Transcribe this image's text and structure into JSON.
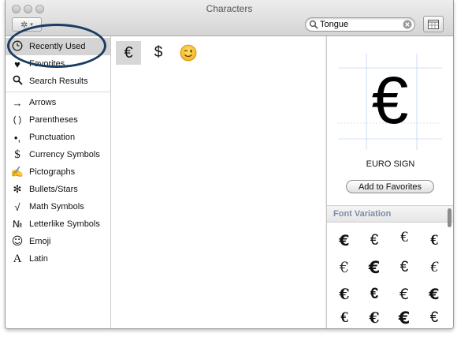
{
  "window": {
    "title": "Characters"
  },
  "toolbar": {
    "gear_icon": "gear-icon",
    "search_value": "Tongue",
    "search_icon": "magnifier-icon",
    "clear_icon": "clear-icon",
    "grid_icon": "character-grid-icon"
  },
  "sidebar": {
    "items": [
      {
        "label": "Recently Used",
        "icon": "🕒",
        "selected": true
      },
      {
        "label": "Favorites",
        "icon": "♥"
      },
      {
        "label": "Search Results",
        "icon": "🔍"
      },
      {
        "label": "Arrows",
        "icon": "→"
      },
      {
        "label": "Parentheses",
        "icon": "( )"
      },
      {
        "label": "Punctuation",
        "icon": "•,"
      },
      {
        "label": "Currency Symbols",
        "icon": "$"
      },
      {
        "label": "Pictographs",
        "icon": "✍"
      },
      {
        "label": "Bullets/Stars",
        "icon": "✻"
      },
      {
        "label": "Math Symbols",
        "icon": "√"
      },
      {
        "label": "Letterlike Symbols",
        "icon": "№"
      },
      {
        "label": "Emoji",
        "icon": "☺"
      },
      {
        "label": "Latin",
        "icon": "A"
      }
    ]
  },
  "main": {
    "characters": [
      "€",
      "$",
      "😉"
    ],
    "selected_index": 0
  },
  "panel": {
    "preview_char": "€",
    "char_name": "EURO SIGN",
    "add_favorites_label": "Add to Favorites",
    "font_variation_title": "Font Variation",
    "variants": [
      "€",
      "€",
      "€",
      "€",
      "€",
      "€",
      "€",
      "€",
      "€",
      "€",
      "€",
      "€",
      "€",
      "€",
      "€",
      "€"
    ]
  },
  "colors": {
    "highlight_ring": "#1b3d63",
    "selection_gray": "#d4d4d4",
    "section_header_text": "#7d8ea3",
    "preview_guides": "#a8c8f0"
  }
}
